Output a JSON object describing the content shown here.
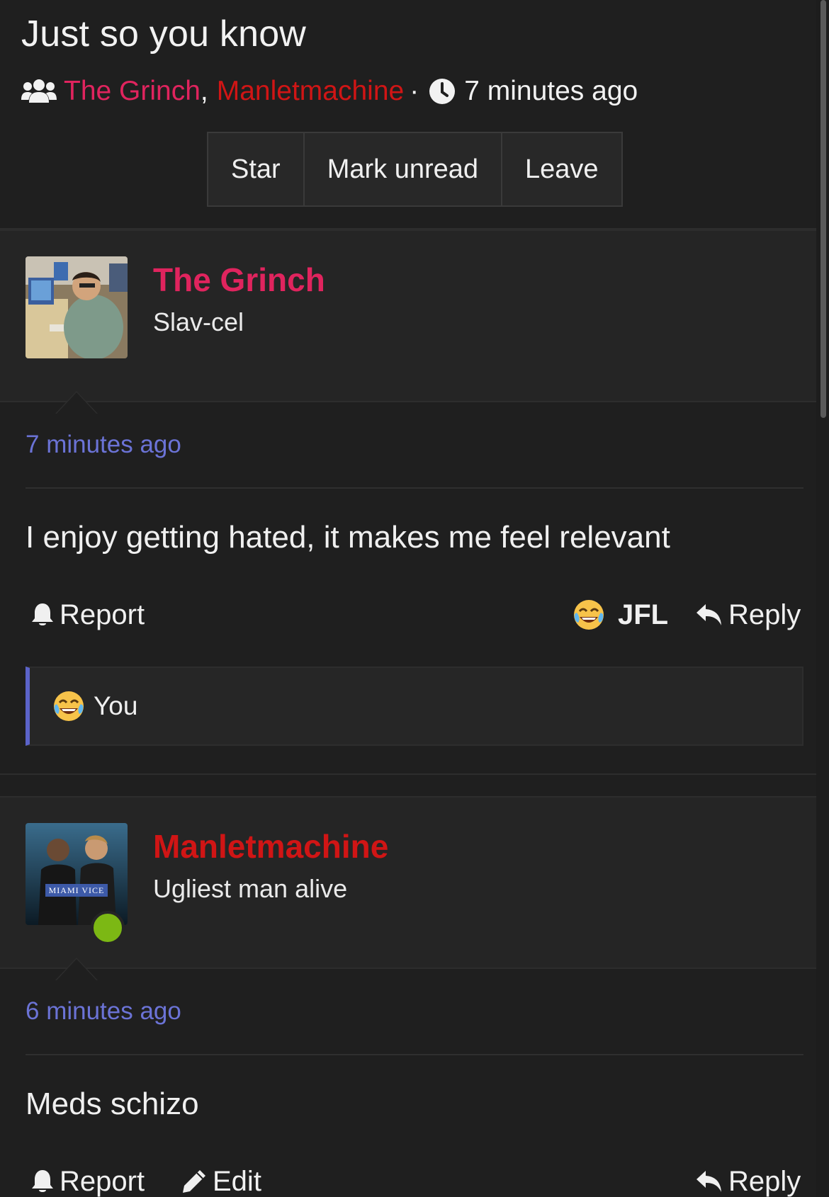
{
  "conversation": {
    "title": "Just so you know",
    "participants": [
      "The Grinch",
      "Manletmachine"
    ],
    "participant_separator": ",",
    "dot": "·",
    "time": "7 minutes ago",
    "buttons": {
      "star": "Star",
      "mark_unread": "Mark unread",
      "leave": "Leave"
    }
  },
  "colors": {
    "grinch": "#e0245e",
    "manlet": "#d01515",
    "timestamp": "#6b73d6",
    "online": "#7cb814"
  },
  "messages": [
    {
      "author": "The Grinch",
      "user_title": "Slav-cel",
      "time": "7 minutes ago",
      "body": "I enjoy getting hated, it makes me feel relevant",
      "actions": {
        "report": "Report",
        "reaction": "JFL",
        "reply": "Reply"
      },
      "reactions_summary": "You",
      "avatar_icon": "avatar-photo"
    },
    {
      "author": "Manletmachine",
      "user_title": "Ugliest man alive",
      "time": "6 minutes ago",
      "body": "Meds schizo",
      "actions": {
        "report": "Report",
        "edit": "Edit",
        "reply": "Reply"
      },
      "avatar_text": "MIAMI VICE",
      "online": true
    }
  ]
}
